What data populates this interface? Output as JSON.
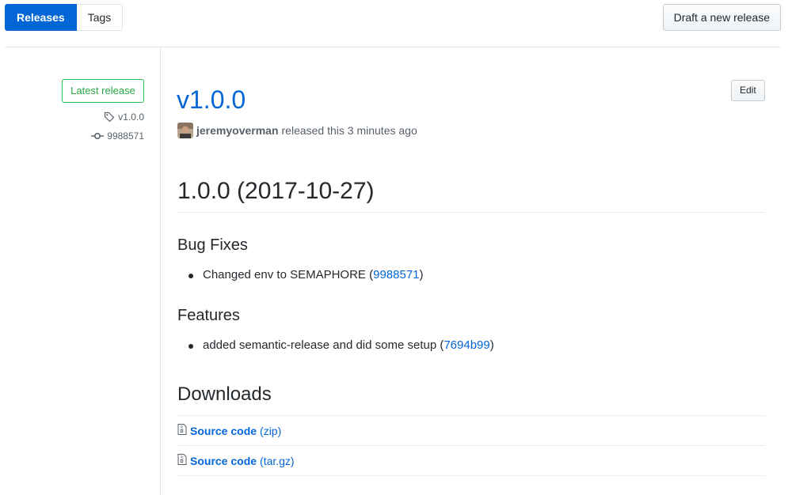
{
  "nav": {
    "tabs": [
      {
        "label": "Releases",
        "selected": true
      },
      {
        "label": "Tags",
        "selected": false
      }
    ],
    "draft_button": "Draft a new release"
  },
  "sidebar": {
    "latest_label": "Latest release",
    "tag": "v1.0.0",
    "commit": "9988571",
    "icons": {
      "tag": "tag-icon",
      "commit": "git-commit-icon"
    }
  },
  "release": {
    "title": "v1.0.0",
    "edit_button": "Edit",
    "author": "jeremyoverman",
    "released_text": "released this 3 minutes ago"
  },
  "notes": {
    "heading": "1.0.0 (2017-10-27)",
    "bug_heading": "Bug Fixes",
    "bug_items": [
      {
        "text": "Changed env to SEMAPHORE (",
        "link": "9988571",
        "suffix": ")"
      }
    ],
    "feature_heading": "Features",
    "feature_items": [
      {
        "text": "added semantic-release and did some setup (",
        "link": "7694b99",
        "suffix": ")"
      }
    ]
  },
  "downloads": {
    "title": "Downloads",
    "items": [
      {
        "name": "Source code",
        "ext": "(zip)",
        "icon": "file-zip-icon"
      },
      {
        "name": "Source code",
        "ext": "(tar.gz)",
        "icon": "file-zip-icon"
      }
    ]
  },
  "colors": {
    "primary": "#0366d6",
    "success": "#28a745",
    "text": "#24292e",
    "muted": "#586069",
    "border": "#e1e4e8"
  }
}
